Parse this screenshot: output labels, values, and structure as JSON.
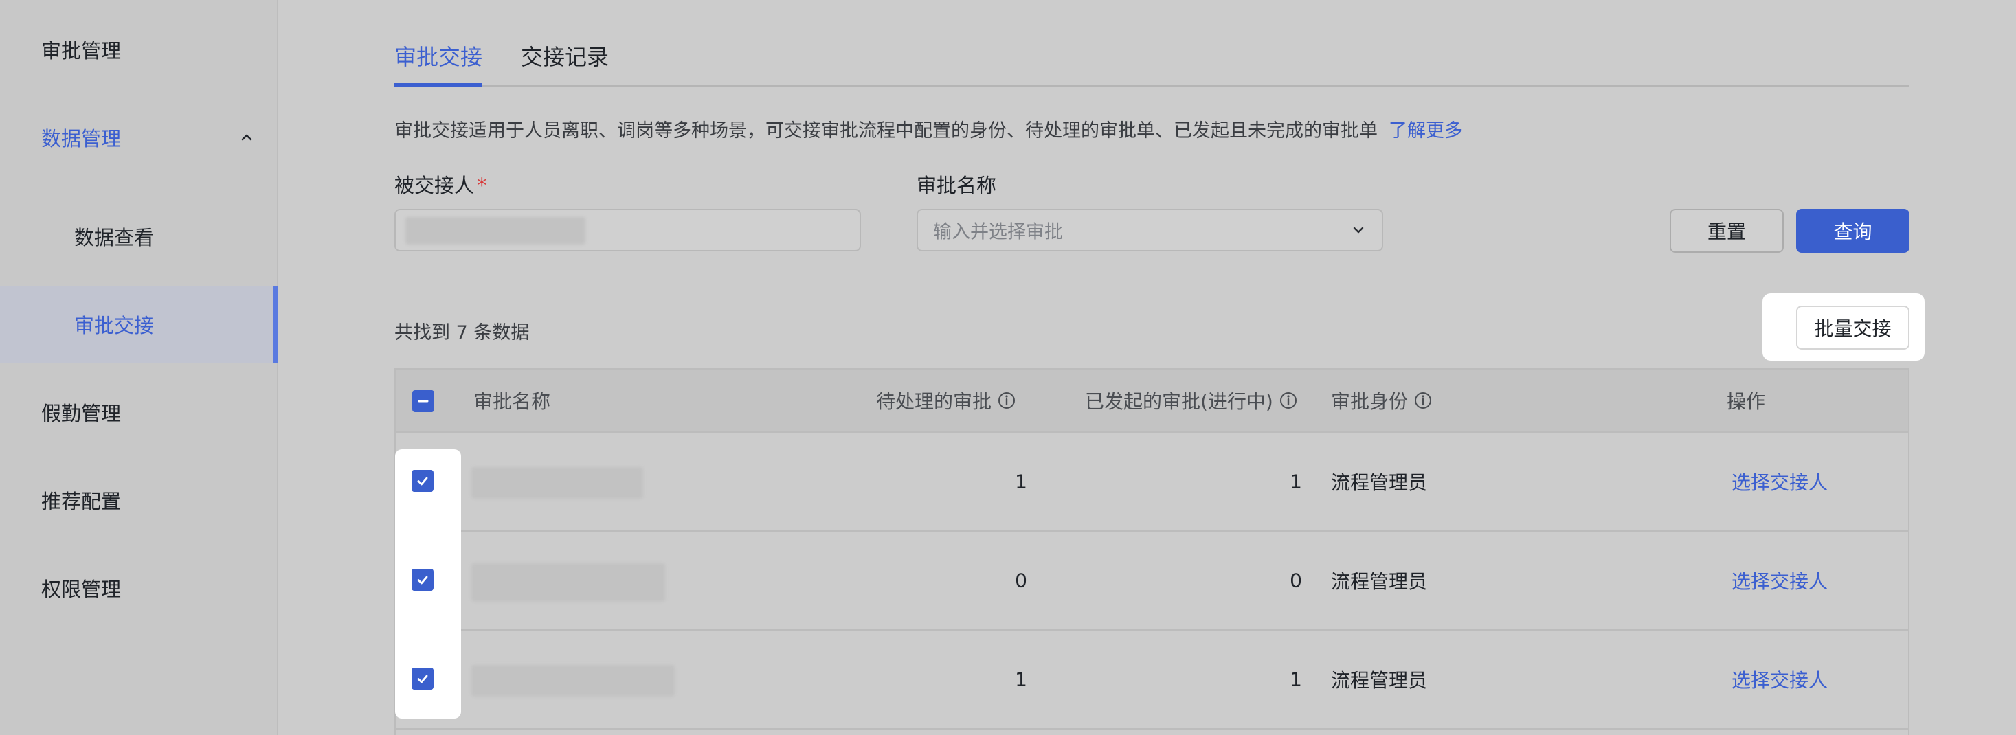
{
  "sidebar": {
    "items": [
      {
        "label": "审批管理"
      },
      {
        "label": "数据管理"
      },
      {
        "label": "数据查看"
      },
      {
        "label": "审批交接"
      },
      {
        "label": "假勤管理"
      },
      {
        "label": "推荐配置"
      },
      {
        "label": "权限管理"
      }
    ]
  },
  "tabs": [
    {
      "label": "审批交接"
    },
    {
      "label": "交接记录"
    }
  ],
  "description": {
    "text": "审批交接适用于人员离职、调岗等多种场景，可交接审批流程中配置的身份、待处理的审批单、已发起且未完成的审批单",
    "link": "了解更多"
  },
  "form": {
    "assignee_label": "被交接人",
    "required_mark": "*",
    "approval_name_label": "审批名称",
    "approval_name_placeholder": "输入并选择审批",
    "reset_label": "重置",
    "query_label": "查询"
  },
  "results": {
    "count_text": "共找到 7 条数据",
    "batch_label": "批量交接"
  },
  "table": {
    "headers": {
      "name": "审批名称",
      "pending": "待处理的审批",
      "initiated": "已发起的审批(进行中)",
      "role": "审批身份",
      "action": "操作"
    },
    "rows": [
      {
        "pending": "1",
        "initiated": "1",
        "role": "流程管理员",
        "action": "选择交接人",
        "checked": true
      },
      {
        "pending": "0",
        "initiated": "0",
        "role": "流程管理员",
        "action": "选择交接人",
        "checked": true
      },
      {
        "pending": "1",
        "initiated": "1",
        "role": "流程管理员",
        "action": "选择交接人",
        "checked": true
      }
    ]
  },
  "colors": {
    "accent": "#3b5fd0",
    "required": "#d83a3a"
  }
}
